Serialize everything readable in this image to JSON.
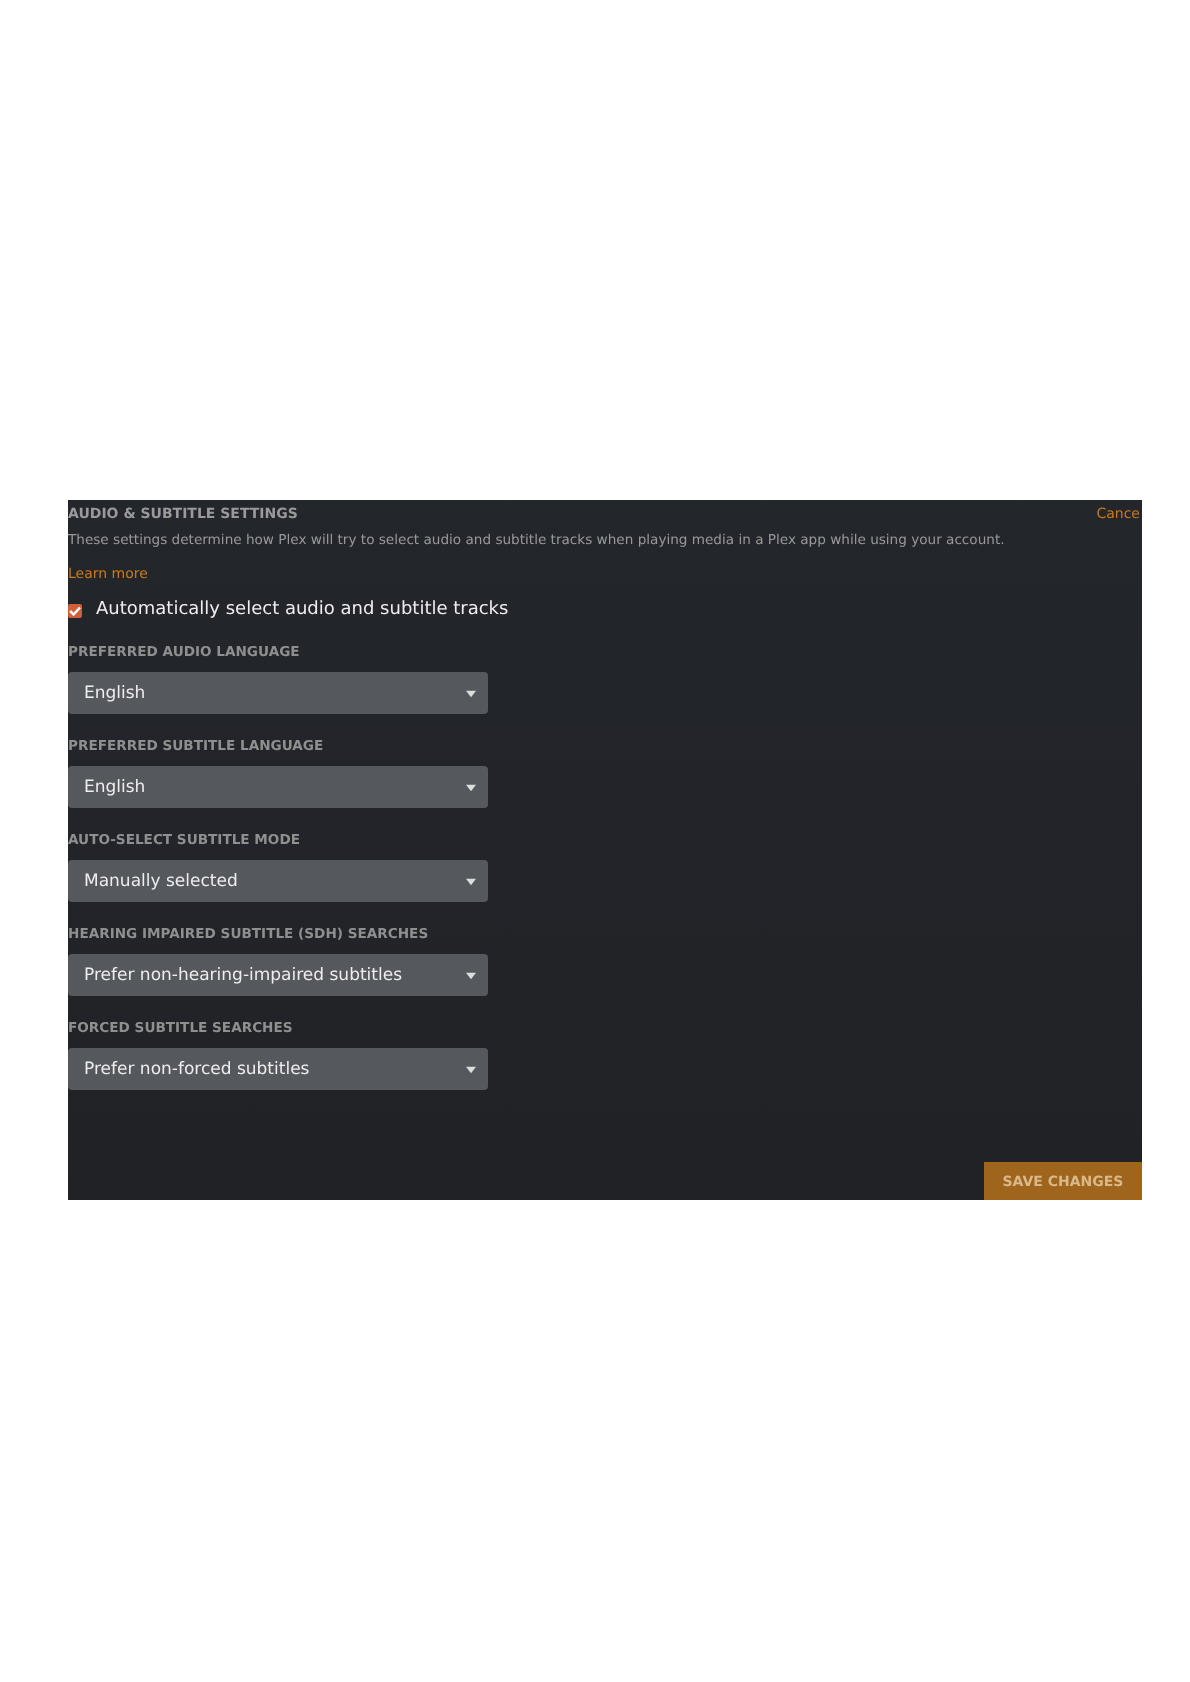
{
  "title": "AUDIO & SUBTITLE SETTINGS",
  "cancel": "Cance",
  "description": "These settings determine how Plex will try to select audio and subtitle tracks when playing media in a Plex app while using your account.",
  "learn_more": "Learn more",
  "auto_select": {
    "label": "Automatically select audio and subtitle tracks",
    "checked": true
  },
  "fields": [
    {
      "label": "PREFERRED AUDIO LANGUAGE",
      "value": "English"
    },
    {
      "label": "PREFERRED SUBTITLE LANGUAGE",
      "value": "English"
    },
    {
      "label": "AUTO-SELECT SUBTITLE MODE",
      "value": "Manually selected"
    },
    {
      "label": "HEARING IMPAIRED SUBTITLE (SDH) SEARCHES",
      "value": "Prefer non-hearing-impaired subtitles"
    },
    {
      "label": "FORCED SUBTITLE SEARCHES",
      "value": "Prefer non-forced subtitles"
    }
  ],
  "save_button": "SAVE CHANGES"
}
